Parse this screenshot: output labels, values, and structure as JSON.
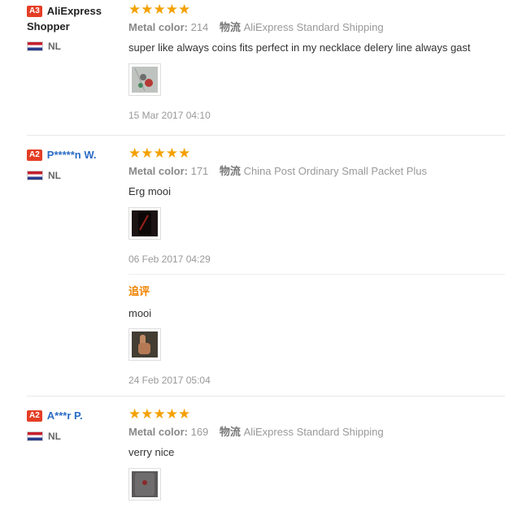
{
  "reviews": [
    {
      "badge": "A3",
      "name_line1": "AliExpress",
      "name_line2": "Shopper",
      "country": "NL",
      "stars": "★★★★★",
      "metal_label": "Metal color:",
      "metal_value": "214",
      "ship_label": "物流",
      "ship_value": "AliExpress Standard Shipping",
      "text": "super like always coins fits perfect in my necklace delery line always gast",
      "date": "15 Mar 2017 04:10"
    },
    {
      "badge": "A2",
      "name": "P*****n W.",
      "country": "NL",
      "stars": "★★★★★",
      "metal_label": "Metal color:",
      "metal_value": "171",
      "ship_label": "物流",
      "ship_value": "China Post Ordinary Small Packet Plus",
      "text": "Erg mooi",
      "date": "06 Feb 2017 04:29",
      "followup": {
        "label": "追评",
        "text": "mooi",
        "date": "24 Feb 2017 05:04"
      }
    },
    {
      "badge": "A2",
      "name": "A***r P.",
      "country": "NL",
      "stars": "★★★★★",
      "metal_label": "Metal color:",
      "metal_value": "169",
      "ship_label": "物流",
      "ship_value": "AliExpress Standard Shipping",
      "text": "verry nice"
    }
  ],
  "colors": {
    "star": "#f4a100",
    "badge": "#e43e25",
    "name_link": "#2a6bc5",
    "followup": "#f08300"
  }
}
